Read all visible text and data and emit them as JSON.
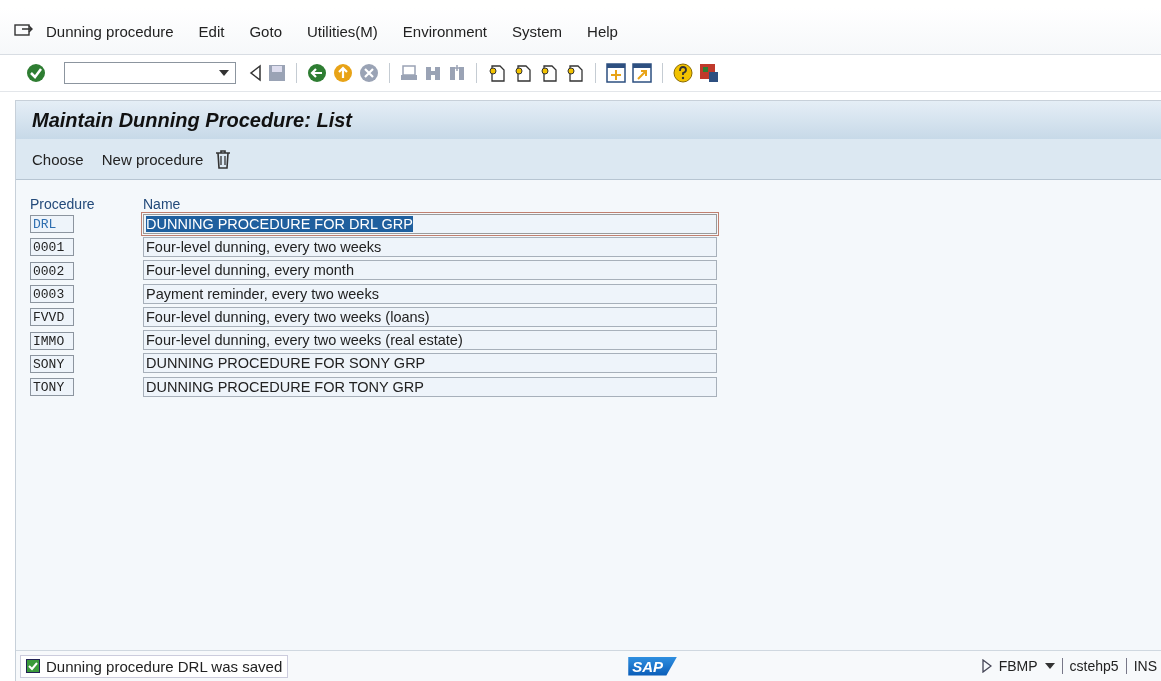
{
  "menu": [
    "Dunning procedure",
    "Edit",
    "Goto",
    "Utilities(M)",
    "Environment",
    "System",
    "Help"
  ],
  "title": "Maintain Dunning Procedure: List",
  "app_toolbar": [
    "Choose",
    "New procedure"
  ],
  "table": {
    "columns": [
      "Procedure",
      "Name"
    ],
    "rows": [
      {
        "procedure": "DRL",
        "name": "DUNNING PROCEDURE FOR DRL GRP",
        "selected": true
      },
      {
        "procedure": "0001",
        "name": "Four-level dunning, every two weeks",
        "selected": false
      },
      {
        "procedure": "0002",
        "name": "Four-level dunning, every month",
        "selected": false
      },
      {
        "procedure": "0003",
        "name": "Payment reminder, every two weeks",
        "selected": false
      },
      {
        "procedure": "FVVD",
        "name": "Four-level dunning, every two weeks (loans)",
        "selected": false
      },
      {
        "procedure": "IMMO",
        "name": "Four-level dunning, every two weeks (real estate)",
        "selected": false
      },
      {
        "procedure": "SONY",
        "name": "DUNNING PROCEDURE FOR SONY GRP",
        "selected": false
      },
      {
        "procedure": "TONY",
        "name": "DUNNING PROCEDURE FOR TONY GRP",
        "selected": false
      }
    ]
  },
  "status_bar": {
    "message": "Dunning procedure DRL was saved",
    "logo": "SAP",
    "transaction": "FBMP",
    "server": "cstehp5",
    "mode": "INS"
  }
}
